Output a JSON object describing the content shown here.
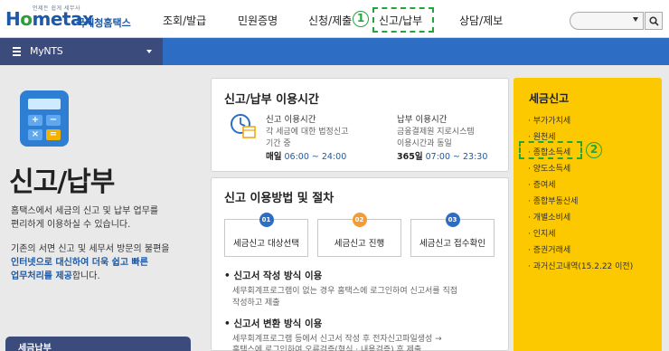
{
  "header": {
    "logo_small": "언제든 쉽게 세무사",
    "logo_main_1": "H",
    "logo_main_o": "o",
    "logo_main_2": "metax",
    "logo_sub": "국세청홈택스",
    "nav": [
      "조회/발급",
      "민원증명",
      "신청/제출",
      "신고/납부",
      "상담/제보"
    ],
    "annotation_1": "1",
    "search_placeholder": ""
  },
  "mybar": {
    "label": "MyNTS"
  },
  "left": {
    "title": "신고/납부",
    "intro_lines": [
      "홈택스에서 세금의 신고 및 납부 업무를",
      "편리하게 이용하실 수 있습니다."
    ],
    "intro2_line1": "기존의 서면 신고 및 세무서 방문의 불편을",
    "intro2_blue1": "인터넷으로 대신하여 더욱 쉽고 빠른",
    "intro2_blue2": "업무처리를 제공",
    "intro2_tail": "합니다.",
    "bottom_label": "세금납부"
  },
  "usage_time": {
    "title": "신고/납부 이용시간",
    "report": {
      "label": "신고 이용시간",
      "desc1": "각 세금에 대한 법정신고",
      "desc2": "기간 중",
      "sched_label": "매일",
      "sched_value": "06:00 ~ 24:00"
    },
    "pay": {
      "label": "납부 이용시간",
      "desc1": "금융결제원 지로시스템",
      "desc2": "이용시간과 동일",
      "sched_label": "365일",
      "sched_value": "07:00 ~ 23:30"
    }
  },
  "procedure": {
    "title": "신고 이용방법 및 절차",
    "steps": [
      {
        "num": "01",
        "label": "세금신고 대상선택"
      },
      {
        "num": "02",
        "label": "세금신고 진행"
      },
      {
        "num": "03",
        "label": "세금신고 접수확인"
      }
    ],
    "method1": {
      "title": "신고서 작성 방식 이용",
      "desc1": "세무회계프로그램이 없는 경우 홈택스에 로그인하여 신고서를 직접",
      "desc2": "작성하고 제출"
    },
    "method2": {
      "title": "신고서 변환 방식 이용",
      "desc1": "세무회계프로그램 등에서 신고서 작성 후 전자신고파일생성 →",
      "desc2": "홈택스에 로그인하여 오류검증(형식 · 내용검증) 후 제출"
    }
  },
  "tax_report": {
    "title": "세금신고",
    "items": [
      "부가가치세",
      "원천세",
      "종합소득세",
      "양도소득세",
      "증여세",
      "종합부동산세",
      "개별소비세",
      "인지세",
      "증권거래세",
      "과거신고내역(15.2.22 이전)"
    ],
    "annotation_2": "2"
  },
  "colors": {
    "brand_blue": "#1c5aa8",
    "nav_bar": "#2d6ec4",
    "mynts_bar": "#3b4b7c",
    "annotation_green": "#22a63c",
    "panel_yellow": "#fcc800",
    "step_01": "#2d6ec4",
    "step_02": "#f39c33",
    "step_03": "#2d6ec4"
  },
  "icons": [
    "calculator-icon",
    "clock-calendar-icon",
    "search-icon",
    "menu-icon",
    "chevron-down-icon"
  ]
}
